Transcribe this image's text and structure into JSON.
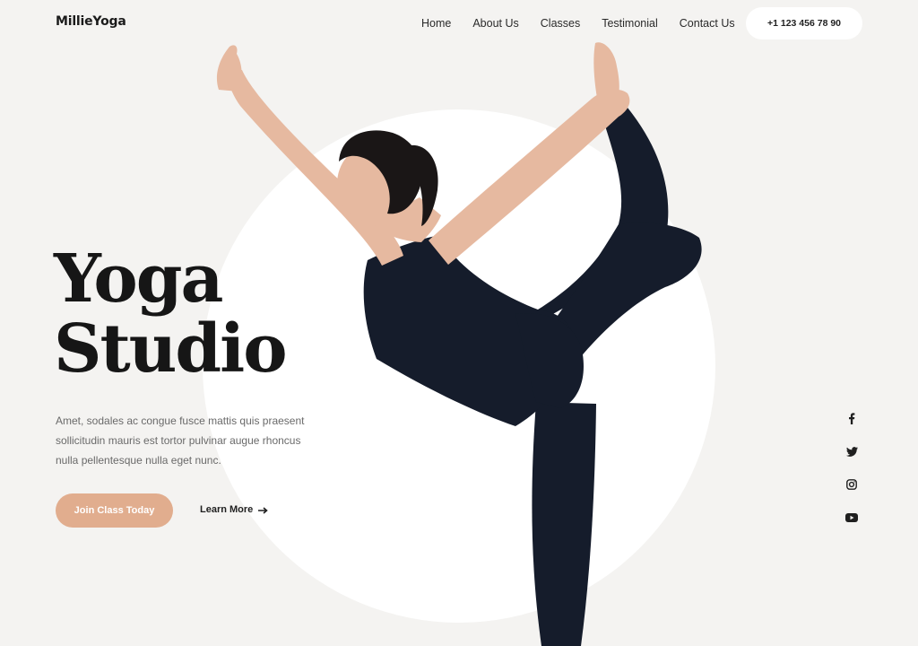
{
  "brand": {
    "name": "MillieYoga"
  },
  "nav": {
    "items": [
      {
        "label": "Home"
      },
      {
        "label": "About Us"
      },
      {
        "label": "Classes"
      },
      {
        "label": "Testimonial"
      },
      {
        "label": "Contact Us"
      }
    ],
    "phone": "+1 123 456 78 90"
  },
  "hero": {
    "title_line1": "Yoga",
    "title_line2": "Studio",
    "description": "Amet, sodales ac congue fusce mattis quis praesent sollicitudin mauris est tortor pulvinar augue rhoncus nulla pellentesque nulla eget nunc.",
    "cta_primary": "Join Class Today",
    "cta_secondary": "Learn More",
    "cta_secondary_icon": "arrow-right-icon"
  },
  "social": {
    "icons": [
      "facebook-icon",
      "twitter-icon",
      "instagram-icon",
      "youtube-icon"
    ]
  },
  "colors": {
    "background": "#f4f3f1",
    "circle": "#ffffff",
    "accent": "#e1ad8e",
    "text_dark": "#161616",
    "text_muted": "#6a6a6a",
    "outfit": "#151c2b",
    "skin": "#e6b9a0"
  }
}
